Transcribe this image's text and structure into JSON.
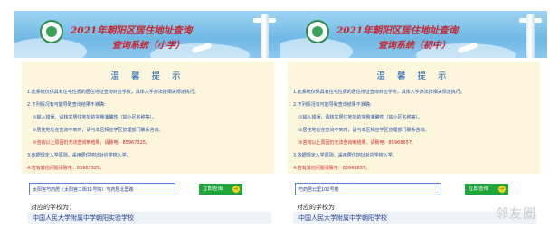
{
  "panels": [
    {
      "banner": {
        "title_line1": "2021年朝阳区居住地址查询",
        "title_line2": "查询系统（小学）"
      },
      "notice": {
        "title": "温 馨 提 示",
        "lines": [
          "1.此系统仅供具有住宅性质的居住地址查询对应学校，具体入学办法按相关规定执行。",
          "2.下列情况有可能导致查询结果不准确：",
          "①输入错误，请核实居住地址的完整准确性（如小区名称等）。",
          "②居住地址在查询不到时，请与本区相应学区管理部门联系咨询。",
          "③咨询以上原因仍无法查询到结果，请致电：85967325。",
          "3.依据规定入学原则，采用居住地址对应学校入学。",
          "4.若有其他问题请致电：85967325。"
        ]
      },
      "search": {
        "value": "太阳宫芍药居（太阳宫二街11号院）芍药居北里路",
        "button_label": "立即查询"
      },
      "result": {
        "label": "对应的学校为：",
        "school": "中国人民大学附属中学朝阳实验学校"
      }
    },
    {
      "banner": {
        "title_line1": "2021年朝阳区居住地址查询",
        "title_line2": "查询系统（初中）"
      },
      "notice": {
        "title": "温 馨 提 示",
        "lines": [
          "1.此系统仅供具有住宅性质的居住地址查询对应学校，具体入学办法按相关规定执行。",
          "2.下列情况有可能导致查询结果不准确：",
          "①输入错误，请核实居住地址的完整准确性（如小区名称等）。",
          "②居住地址在查询不到时，请与本区相应学区管理部门联系咨询。",
          "③咨询以上原因仍无法查询到结果，请致电：85968657。",
          "3.依据规定入学原则，采用居住地址对应学校入学。",
          "4.若有其他问题请致电：85968657。"
        ]
      },
      "search": {
        "value": "芍药居北里102号楼",
        "button_label": "立即查询"
      },
      "result": {
        "label": "对应的学校为：",
        "school": "中国人民大学附属中学朝阳学校"
      }
    }
  ],
  "watermark": "邻友圈",
  "colors": {
    "banner_sky": "#6fb8e6",
    "banner_title": "#c8232c",
    "notice_bg": "#fbf6dc",
    "notice_text": "#1f4ea8",
    "notice_highlight": "#d2232a",
    "button_bg": "#20a53a",
    "result_bg": "#eef2f9"
  }
}
